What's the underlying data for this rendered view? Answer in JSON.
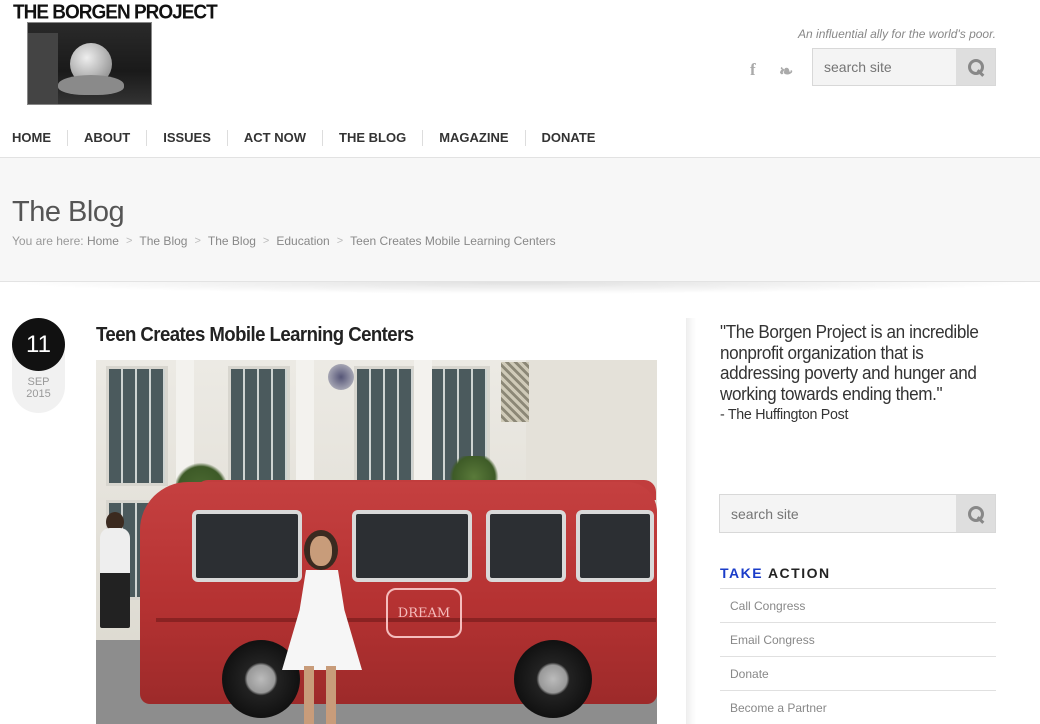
{
  "header": {
    "logo_text": "THE BORGEN PROJECT",
    "tagline": "An influential ally for the world's poor.",
    "social": {
      "facebook_glyph": "f",
      "twitter_glyph": "❧"
    },
    "search": {
      "placeholder": "search site"
    }
  },
  "nav": {
    "items": [
      {
        "label": "HOME"
      },
      {
        "label": "ABOUT"
      },
      {
        "label": "ISSUES"
      },
      {
        "label": "ACT NOW"
      },
      {
        "label": "THE BLOG"
      },
      {
        "label": "MAGAZINE"
      },
      {
        "label": "DONATE"
      }
    ]
  },
  "page": {
    "title": "The Blog",
    "breadcrumb": {
      "prefix": "You are here:",
      "items": [
        "Home",
        "The Blog",
        "The Blog",
        "Education",
        "Teen Creates Mobile Learning Centers"
      ],
      "separator": ">"
    }
  },
  "post": {
    "day": "11",
    "month": "SEP",
    "year": "2015",
    "title": "Teen Creates Mobile Learning Centers",
    "image_sign": "DREAM"
  },
  "sidebar": {
    "quote": "\"The Borgen Project is an incredible nonprofit organization that is addressing poverty and hunger and working towards ending them.\"",
    "quote_attribution": "- The Huffington Post",
    "search": {
      "placeholder": "search site"
    },
    "take_action": {
      "heading_accent": "TAKE",
      "heading_rest": " ACTION",
      "items": [
        {
          "label": "Call Congress"
        },
        {
          "label": "Email Congress"
        },
        {
          "label": "Donate"
        },
        {
          "label": "Become a Partner"
        }
      ]
    }
  },
  "colors": {
    "accent": "#1a3cc9",
    "date_circle": "#111111",
    "band_bg": "#f7f7f7"
  }
}
